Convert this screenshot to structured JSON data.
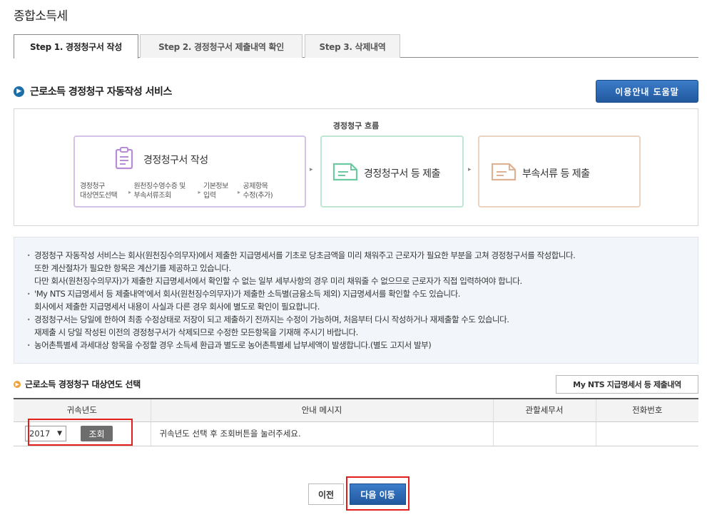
{
  "page": {
    "title": "종합소득세"
  },
  "tabs": [
    {
      "label": "Step 1. 경정청구서 작성"
    },
    {
      "label": "Step 2. 경정청구서 제출내역 확인"
    },
    {
      "label": "Step 3. 삭제내역"
    }
  ],
  "section1": {
    "title": "근로소득 경정청구 자동작성 서비스",
    "help_button": "이용안내 도움말"
  },
  "flow": {
    "title": "경정청구 흐름",
    "card1": {
      "title": "경정청구서 작성",
      "substeps": [
        {
          "line1": "경정청구",
          "line2": "대상연도선택"
        },
        {
          "line1": "원천징수영수증 및",
          "line2": "부속서류조회"
        },
        {
          "line1": "기본정보",
          "line2": "입력"
        },
        {
          "line1": "공제항목",
          "line2": "수정(추가)"
        }
      ]
    },
    "card2": {
      "title": "경정청구서 등 제출"
    },
    "card3": {
      "title": "부속서류 등 제출"
    }
  },
  "info": [
    "경정청구 자동작성 서비스는 회사(원천징수의무자)에서 제출한 지급명세서를 기초로 당초금액을 미리 채워주고 근로자가 필요한 부분을 고쳐 경정청구서를 작성합니다.",
    "또한 계산절차가 필요한 항목은 계산기를 제공하고 있습니다.",
    "다만 회사(원천징수의무자)가 제출한 지급명세서에서 확인할 수 없는 일부 세부사항의 경우 미리 채워줄 수 없으므로 근로자가 직접 입력하여야 합니다.",
    "'My NTS 지급명세서 등 제출내역'에서 회사(원천징수의무자)가 제출한 소득별(금융소득 제외) 지급명세서를 확인할 수도 있습니다.",
    "회사에서 제출한 지급명세서 내용이 사실과 다른 경우 회사에 별도로 확인이 필요합니다.",
    "경정청구서는 당일에 한하여 최종 수정상태로 저장이 되고 제출하기 전까지는 수정이 가능하며, 처음부터 다시 작성하거나 재제출할 수도 있습니다.",
    "재제출 시 당일 작성된 이전의 경정청구서가 삭제되므로 수정한 모든항목을 기재해 주시기 바랍니다.",
    "농어촌특별세 과세대상 항목을 수정할 경우 소득세 환급과 별도로 농어촌특별세 납부세액이 발생합니다.(별도 고지서 발부)"
  ],
  "section2": {
    "title": "근로소득 경정청구 대상연도 선택",
    "nts_button": "My NTS 지급명세서 등 제출내역"
  },
  "table": {
    "headers": [
      "귀속년도",
      "안내 메시지",
      "관할세무서",
      "전화번호"
    ],
    "row": {
      "year": "2017",
      "query_button": "조회",
      "message": "귀속년도 선택 후 조회버튼을 눌러주세요.",
      "office": "",
      "phone": ""
    }
  },
  "buttons": {
    "prev": "이전",
    "next": "다음 이동"
  },
  "colors": {
    "accent_blue": "#2a67b1",
    "highlight_red": "#e41d1d"
  }
}
